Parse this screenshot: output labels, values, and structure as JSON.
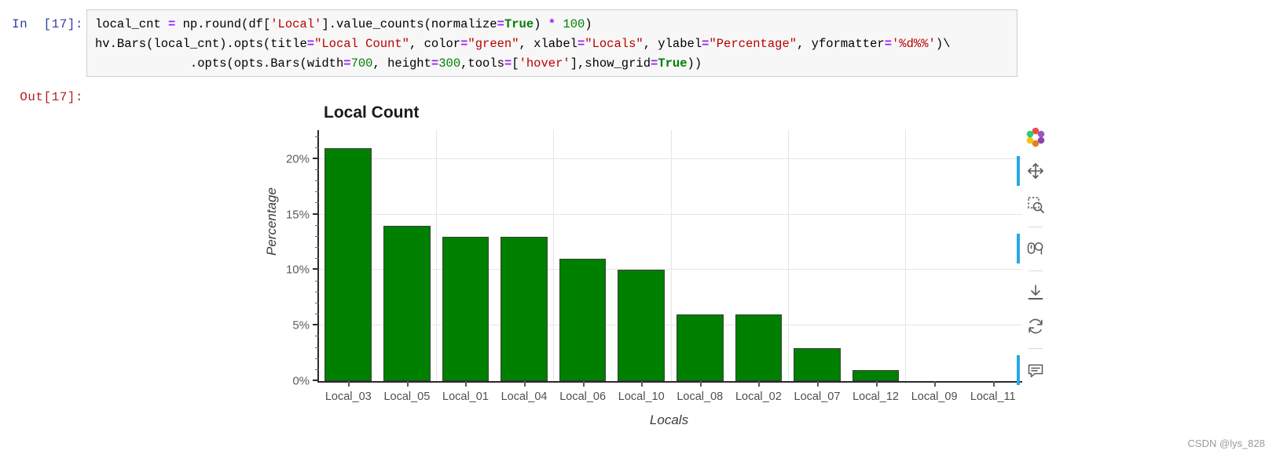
{
  "notebook": {
    "input_prompt": "In  [17]:",
    "output_prompt": "Out[17]:",
    "code_lines": [
      [
        {
          "t": "local_cnt ",
          "c": "plain"
        },
        {
          "t": "=",
          "c": "op"
        },
        {
          "t": " np.round(df[",
          "c": "plain"
        },
        {
          "t": "'Local'",
          "c": "str"
        },
        {
          "t": "].value_counts(normalize",
          "c": "plain"
        },
        {
          "t": "=",
          "c": "op"
        },
        {
          "t": "True",
          "c": "bool"
        },
        {
          "t": ") ",
          "c": "plain"
        },
        {
          "t": "*",
          "c": "op"
        },
        {
          "t": " ",
          "c": "plain"
        },
        {
          "t": "100",
          "c": "num"
        },
        {
          "t": ")",
          "c": "plain"
        }
      ],
      [
        {
          "t": "hv.Bars(local_cnt).opts(title",
          "c": "plain"
        },
        {
          "t": "=",
          "c": "op"
        },
        {
          "t": "\"Local Count\"",
          "c": "str"
        },
        {
          "t": ", color",
          "c": "plain"
        },
        {
          "t": "=",
          "c": "op"
        },
        {
          "t": "\"green\"",
          "c": "str"
        },
        {
          "t": ", xlabel",
          "c": "plain"
        },
        {
          "t": "=",
          "c": "op"
        },
        {
          "t": "\"Locals\"",
          "c": "str"
        },
        {
          "t": ", ylabel",
          "c": "plain"
        },
        {
          "t": "=",
          "c": "op"
        },
        {
          "t": "\"Percentage\"",
          "c": "str"
        },
        {
          "t": ", yformatter",
          "c": "plain"
        },
        {
          "t": "=",
          "c": "op"
        },
        {
          "t": "'%d%%'",
          "c": "str"
        },
        {
          "t": ")\\",
          "c": "plain"
        }
      ],
      [
        {
          "t": "             .opts(opts.Bars(width",
          "c": "plain"
        },
        {
          "t": "=",
          "c": "op"
        },
        {
          "t": "700",
          "c": "num"
        },
        {
          "t": ", height",
          "c": "plain"
        },
        {
          "t": "=",
          "c": "op"
        },
        {
          "t": "300",
          "c": "num"
        },
        {
          "t": ",tools",
          "c": "plain"
        },
        {
          "t": "=",
          "c": "op"
        },
        {
          "t": "[",
          "c": "plain"
        },
        {
          "t": "'hover'",
          "c": "str"
        },
        {
          "t": "],show_grid",
          "c": "plain"
        },
        {
          "t": "=",
          "c": "op"
        },
        {
          "t": "True",
          "c": "bool"
        },
        {
          "t": "))",
          "c": "plain"
        }
      ]
    ]
  },
  "chart_data": {
    "type": "bar",
    "title": "Local Count",
    "xlabel": "Locals",
    "ylabel": "Percentage",
    "categories": [
      "Local_03",
      "Local_05",
      "Local_01",
      "Local_04",
      "Local_06",
      "Local_10",
      "Local_08",
      "Local_02",
      "Local_07",
      "Local_12",
      "Local_09",
      "Local_11"
    ],
    "values": [
      21,
      14,
      13,
      13,
      11,
      10,
      6,
      6,
      3,
      1,
      0,
      0
    ],
    "ylim": [
      0,
      22.6
    ],
    "ytick_values": [
      0,
      5,
      10,
      15,
      20
    ],
    "ytick_labels": [
      "0%",
      "5%",
      "10%",
      "15%",
      "20%"
    ],
    "yminor_step": 1,
    "grid": true,
    "legend": "none",
    "bar_color": "#008000",
    "bar_line_color": "#3c3c3c",
    "grid_color": "#e5e5e5",
    "axis_color": "#2a2a2a"
  },
  "toolbar": {
    "items": [
      {
        "name": "bokeh-logo-icon",
        "label": "Bokeh",
        "active": false,
        "sep_after": false
      },
      {
        "name": "pan-tool-icon",
        "label": "Pan",
        "active": true,
        "sep_after": false
      },
      {
        "name": "box-zoom-icon",
        "label": "Box Zoom",
        "active": false,
        "sep_after": true
      },
      {
        "name": "wheel-zoom-icon",
        "label": "Wheel Zoom",
        "active": true,
        "sep_after": true
      },
      {
        "name": "save-icon",
        "label": "Save",
        "active": false,
        "sep_after": false
      },
      {
        "name": "reset-icon",
        "label": "Reset",
        "active": false,
        "sep_after": true
      },
      {
        "name": "hover-tool-icon",
        "label": "Hover",
        "active": true,
        "sep_after": false
      }
    ],
    "accent_color": "#26a8e0"
  },
  "watermark": {
    "text": "CSDN @lys_828"
  }
}
